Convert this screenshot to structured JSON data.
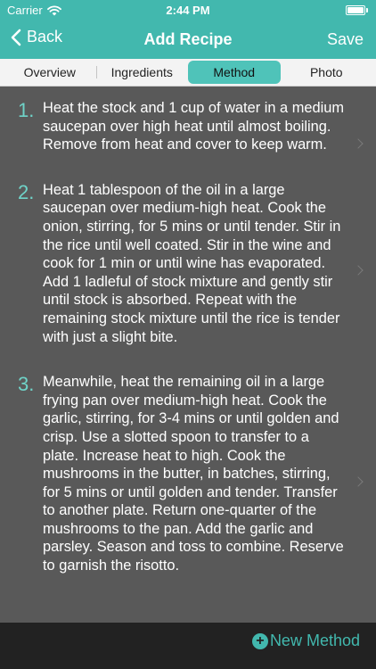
{
  "status": {
    "carrier": "Carrier",
    "time": "2:44 PM"
  },
  "nav": {
    "back_label": "Back",
    "title": "Add Recipe",
    "save_label": "Save"
  },
  "tabs": [
    {
      "label": "Overview"
    },
    {
      "label": "Ingredients"
    },
    {
      "label": "Method"
    },
    {
      "label": "Photo"
    }
  ],
  "active_tab": "Method",
  "steps": [
    {
      "number": "1.",
      "text": "Heat the stock and 1 cup of water in a medium saucepan over high heat until almost boiling. Remove from heat and cover to keep warm."
    },
    {
      "number": "2.",
      "text": "Heat 1 tablespoon of the oil in a large saucepan over medium-high heat. Cook the onion, stirring, for 5 mins or until tender. Stir in the rice until well coated. Stir in the wine and cook for 1 min or until wine has evaporated. Add 1 ladleful of stock mixture and gently stir until stock is absorbed. Repeat with the remaining stock mixture until the rice is tender with just a slight bite."
    },
    {
      "number": "3.",
      "text": "Meanwhile, heat the remaining oil in a large frying pan over medium-high heat. Cook the garlic, stirring, for 3-4 mins or until golden and crisp. Use a slotted spoon to transfer to a plate. Increase heat to high. Cook the mushrooms in the butter, in batches, stirring, for 5 mins or until golden and tender. Transfer to another plate. Return one-quarter of the mushrooms to the pan. Add the garlic and parsley. Season and toss to combine. Reserve to garnish the risotto."
    }
  ],
  "footer": {
    "new_method_label": "New Method"
  },
  "colors": {
    "accent": "#42b8ae",
    "step_number": "#6fd3c8",
    "content_bg": "#595959",
    "footer_bg": "#222222"
  },
  "icons": {
    "back": "chevron-left-icon",
    "wifi": "wifi-icon",
    "battery": "battery-icon",
    "add": "plus-circle-icon",
    "row_disclosure": "chevron-right-icon"
  }
}
